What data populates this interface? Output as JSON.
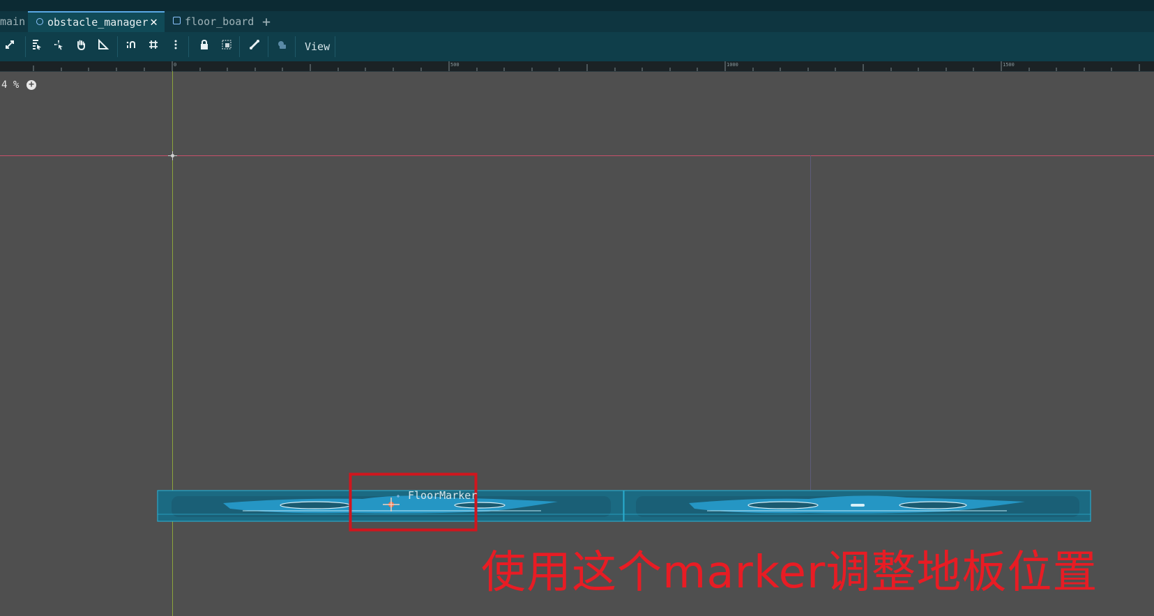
{
  "tabs": [
    {
      "label": "main",
      "state": "inactive"
    },
    {
      "label": "obstacle_manager",
      "state": "active",
      "icon": "node2d-icon",
      "close": "✕"
    },
    {
      "label": "floor_board",
      "state": "inactive",
      "icon": "control-icon"
    }
  ],
  "add_tab": "+",
  "toolbar": {
    "view_label": "View"
  },
  "ruler": {
    "labels": [
      "0",
      "500",
      "1000",
      "1500"
    ]
  },
  "zoom": {
    "value": "4 %",
    "plus": "+"
  },
  "scene": {
    "node_label": "FloorMarker"
  },
  "annotation": {
    "text": "使用这个marker调整地板位置",
    "color": "#e81c24"
  },
  "colors": {
    "tab_bar": "#0e3540",
    "toolbar": "#0f3e4a",
    "canvas": "#4f4f4f",
    "floor": "#1e86ad"
  }
}
